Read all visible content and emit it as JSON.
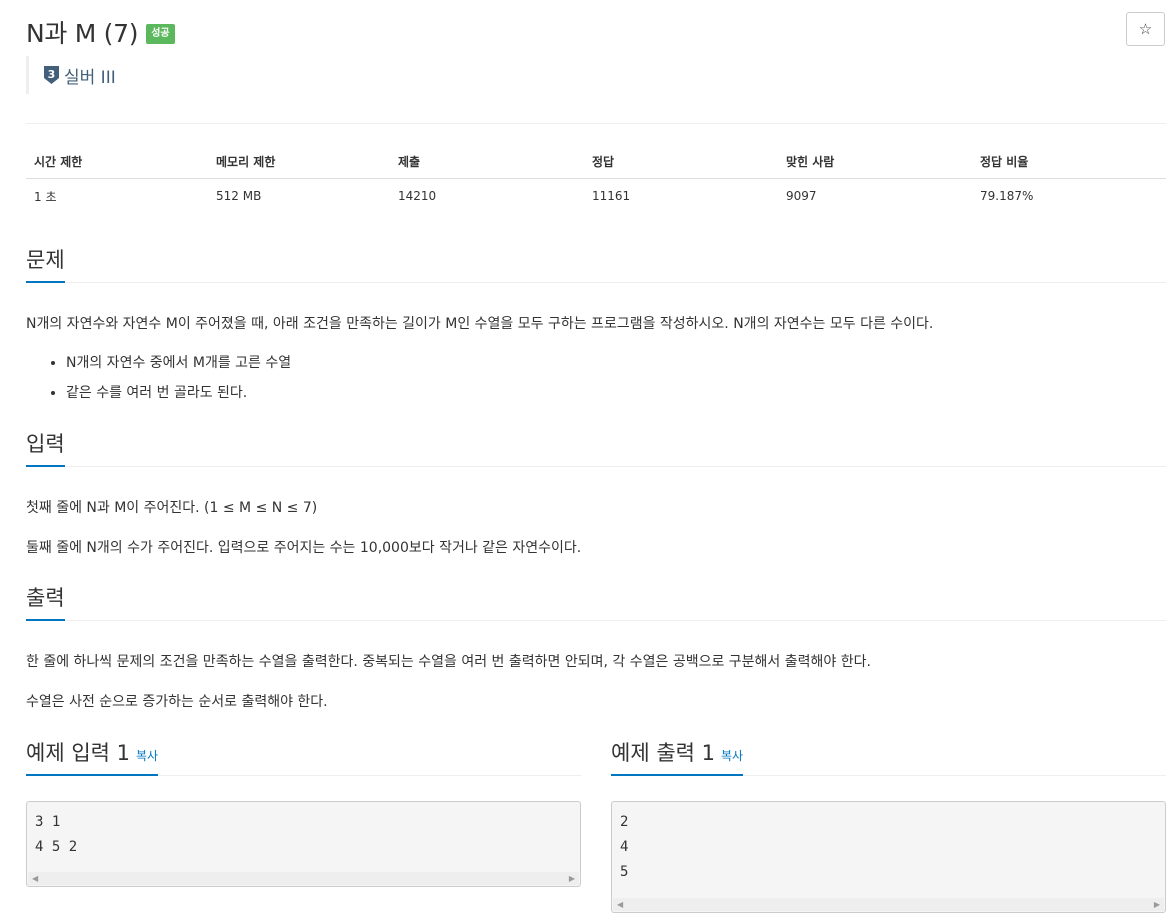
{
  "header": {
    "title": "N과 M (7)",
    "status_badge": "성공",
    "star_label": "☆",
    "tier_number": "3",
    "tier_label": "실버 III"
  },
  "info_table": {
    "headers": [
      "시간 제한",
      "메모리 제한",
      "제출",
      "정답",
      "맞힌 사람",
      "정답 비율"
    ],
    "values": [
      "1 초",
      "512 MB",
      "14210",
      "11161",
      "9097",
      "79.187%"
    ]
  },
  "problem": {
    "heading": "문제",
    "text": "N개의 자연수와 자연수 M이 주어졌을 때, 아래 조건을 만족하는 길이가 M인 수열을 모두 구하는 프로그램을 작성하시오. N개의 자연수는 모두 다른 수이다.",
    "conditions": [
      "N개의 자연수 중에서 M개를 고른 수열",
      "같은 수를 여러 번 골라도 된다."
    ]
  },
  "input": {
    "heading": "입력",
    "lines": [
      "첫째 줄에 N과 M이 주어진다. (1 ≤ M ≤ N ≤ 7)",
      "둘째 줄에 N개의 수가 주어진다. 입력으로 주어지는 수는 10,000보다 작거나 같은 자연수이다."
    ]
  },
  "output": {
    "heading": "출력",
    "lines": [
      "한 줄에 하나씩 문제의 조건을 만족하는 수열을 출력한다. 중복되는 수열을 여러 번 출력하면 안되며, 각 수열은 공백으로 구분해서 출력해야 한다.",
      "수열은 사전 순으로 증가하는 순서로 출력해야 한다."
    ]
  },
  "sample_input": {
    "heading": "예제 입력 1",
    "copy_label": "복사",
    "lines": [
      "3 1",
      "4 5 2"
    ]
  },
  "sample_output": {
    "heading": "예제 출력 1",
    "copy_label": "복사",
    "lines": [
      "2",
      "4",
      "5"
    ]
  },
  "colors": {
    "accent": "#0076c0",
    "success": "#5cb85c",
    "tier": "#435f7a"
  }
}
